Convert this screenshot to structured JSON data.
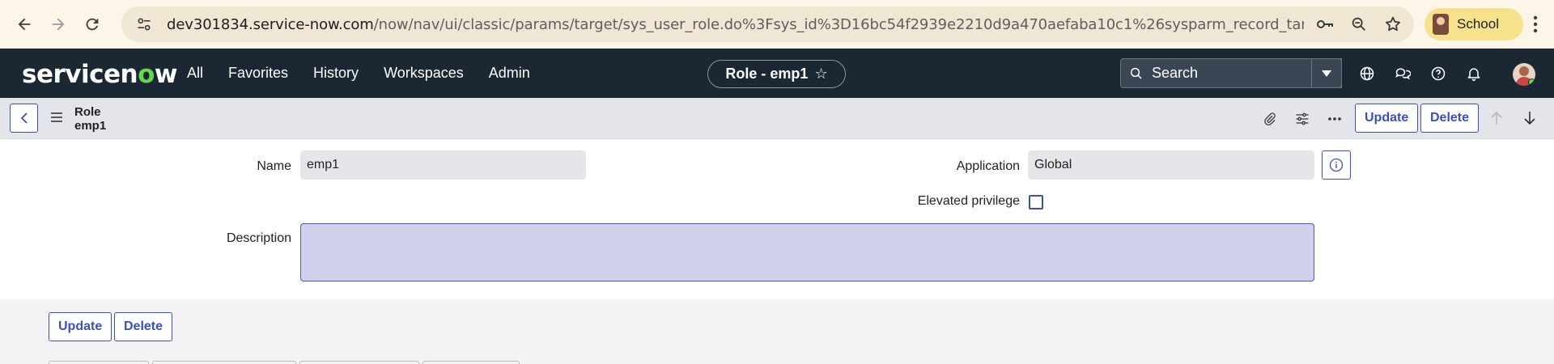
{
  "browser": {
    "url_host": "dev301834.service-now.com",
    "url_path": "/now/nav/ui/classic/params/target/sys_user_role.do%3Fsys_id%3D16bc54f2939e2210d9a470aefaba10c1%26sysparm_record_target%3Dsys_user_role%26...",
    "profile_label": "School",
    "icons": [
      "back-icon",
      "forward-icon",
      "reload-icon",
      "site-info-icon",
      "password-key-icon",
      "zoom-icon",
      "bookmark-star-icon",
      "chrome-menu-icon"
    ]
  },
  "header": {
    "logo_text_before": "servicen",
    "logo_text_o": "o",
    "logo_text_after": "w",
    "nav": [
      "All",
      "Favorites",
      "History",
      "Workspaces",
      "Admin"
    ],
    "context_pill": "Role - emp1",
    "search_placeholder": "Search",
    "icons": [
      "globe-icon",
      "chat-icon",
      "help-icon",
      "bell-icon",
      "user-avatar"
    ]
  },
  "form_bar": {
    "title_line1": "Role",
    "title_line2": "emp1",
    "update_label": "Update",
    "delete_label": "Delete"
  },
  "form": {
    "name_label": "Name",
    "name_value": "emp1",
    "application_label": "Application",
    "application_value": "Global",
    "elevated_label": "Elevated privilege",
    "elevated_checked": false,
    "description_label": "Description",
    "description_value": ""
  },
  "bottom": {
    "update_label": "Update",
    "delete_label": "Delete"
  },
  "colors": {
    "accent": "#3c4fbf",
    "header_bg": "#1b2733",
    "logo_green": "#62d84e"
  }
}
